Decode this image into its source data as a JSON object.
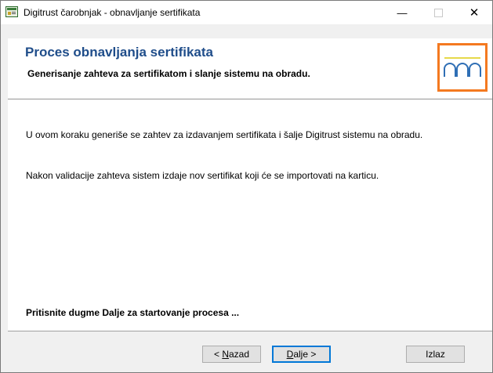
{
  "window": {
    "title": "Digitrust čarobnjak - obnavljanje sertifikata",
    "minimize_glyph": "—",
    "close_glyph": "✕"
  },
  "header": {
    "title": "Proces obnavljanja sertifikata",
    "subtitle": "Generisanje zahteva za sertifikatom i slanje sistemu na obradu.",
    "logo_color": "#f47920",
    "logo_accent": "#e6d94a"
  },
  "content": {
    "paragraph1": "U ovom koraku generiše se zahtev za izdavanjem sertifikata i šalje Digitrust sistemu na obradu.",
    "paragraph2": "Nakon validacije zahteva sistem izdaje nov sertifikat koji će se importovati na karticu.",
    "instruction": "Pritisnite dugme Dalje za startovanje procesa ..."
  },
  "buttons": {
    "back_prefix": "< ",
    "back_mnemonic": "N",
    "back_rest": "azad",
    "next_mnemonic": "D",
    "next_rest": "alje >",
    "exit": "Izlaz"
  }
}
